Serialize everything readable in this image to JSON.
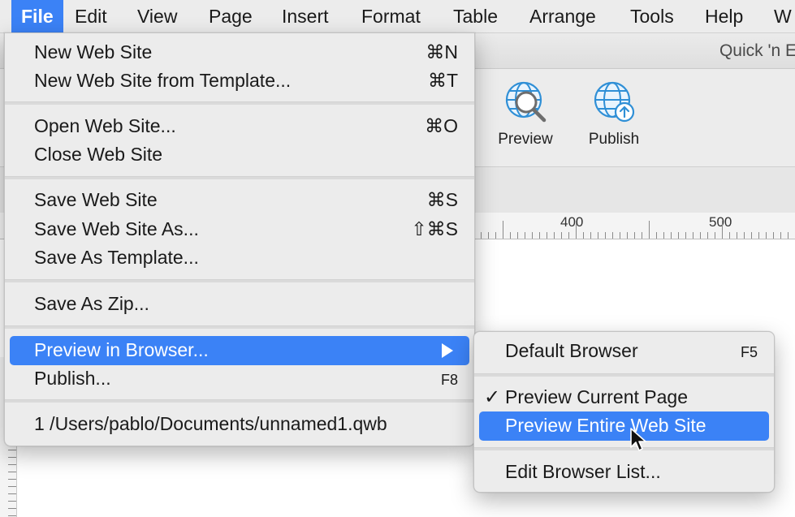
{
  "menubar": {
    "items": [
      "File",
      "Edit",
      "View",
      "Page",
      "Insert",
      "Format",
      "Table",
      "Arrange",
      "Tools",
      "Help",
      "W"
    ],
    "active": "File"
  },
  "window": {
    "title": "Quick 'n E"
  },
  "toolbar": {
    "preview_label": "Preview",
    "publish_label": "Publish",
    "preview_icon": "globe-magnifier-icon",
    "publish_icon": "globe-upload-icon"
  },
  "ruler": {
    "labels": [
      "400",
      "500"
    ]
  },
  "file_menu": {
    "items": [
      {
        "label": "New Web Site",
        "shortcut": "⌘N"
      },
      {
        "label": "New Web Site from Template...",
        "shortcut": "⌘T"
      },
      {
        "label": "Open Web Site...",
        "shortcut": "⌘O"
      },
      {
        "label": "Close Web Site",
        "shortcut": ""
      },
      {
        "label": "Save Web Site",
        "shortcut": "⌘S"
      },
      {
        "label": "Save Web Site As...",
        "shortcut": "⇧⌘S"
      },
      {
        "label": "Save As Template...",
        "shortcut": ""
      },
      {
        "label": "Save As Zip...",
        "shortcut": ""
      },
      {
        "label": "Preview in Browser...",
        "shortcut": ""
      },
      {
        "label": "Publish...",
        "shortcut": "F8"
      },
      {
        "label": "1 /Users/pablo/Documents/unnamed1.qwb",
        "shortcut": ""
      }
    ],
    "highlighted": "Preview in Browser..."
  },
  "preview_submenu": {
    "items": [
      {
        "label": "Default Browser",
        "shortcut": "F5"
      },
      {
        "label": "Preview Current Page",
        "checked": true
      },
      {
        "label": "Preview Entire Web Site",
        "highlighted": true
      },
      {
        "label": "Edit Browser List..."
      }
    ],
    "check_mark": "✓"
  },
  "colors": {
    "highlight": "#3b82f6",
    "menu_bg": "#ececec"
  }
}
